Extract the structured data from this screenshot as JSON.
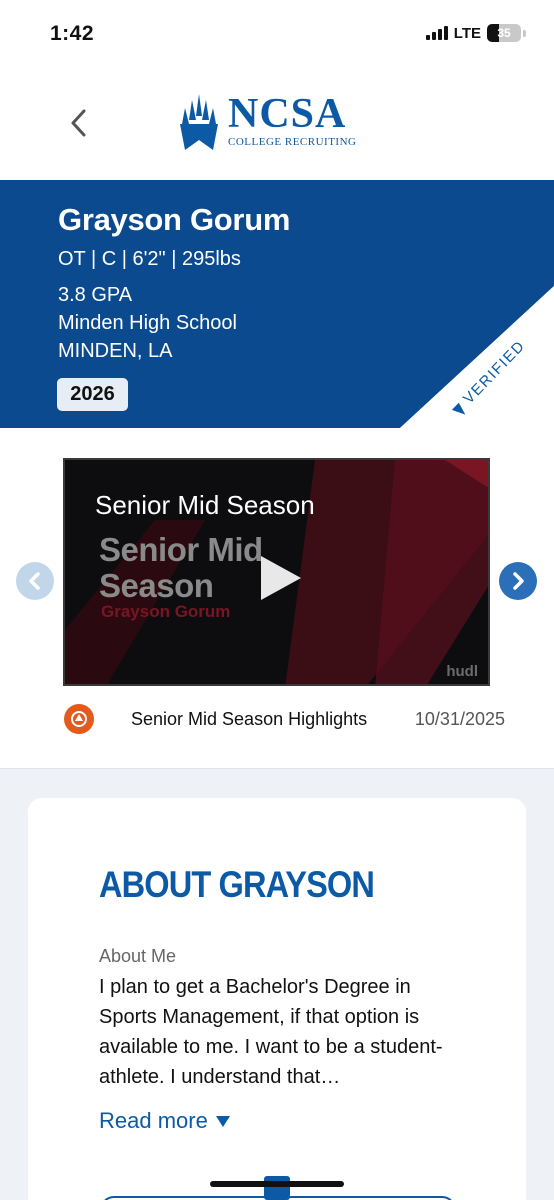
{
  "status_bar": {
    "time": "1:42",
    "network": "LTE",
    "battery": "35",
    "battery_level": 0.35
  },
  "header": {
    "logo_word": "NCSA",
    "logo_sub": "COLLEGE RECRUITING"
  },
  "profile": {
    "name": "Grayson Gorum",
    "stats": "OT | C | 6'2\" | 295lbs",
    "gpa": "3.8 GPA",
    "school": "Minden High School",
    "location": "MINDEN, LA",
    "class_year": "2026",
    "verified": "VERIFIED"
  },
  "video": {
    "title": "Senior Mid Season",
    "card_big_line1": "Senior Mid",
    "card_big_line2": "Season",
    "card_small": "Grayson Gorum",
    "watermark": "hudl",
    "caption": "Senior Mid Season Highlights",
    "date": "10/31/2025"
  },
  "about": {
    "title": "ABOUT GRAYSON",
    "label": "About Me",
    "text": "I plan to get a Bachelor's Degree in Sports Management, if that option is available to me. I want to be a student-athlete. I understand that…",
    "read_more": "Read more"
  },
  "colors": {
    "brand_blue": "#0c5aa6",
    "banner_blue": "#0c4a8f",
    "hudl_orange": "#e25a1c"
  },
  "icons": [
    "back-chevron-icon",
    "ncsa-logo-icon",
    "verified-check-icon",
    "play-icon",
    "chevron-left-icon",
    "chevron-right-icon",
    "hudl-icon",
    "caret-down-icon"
  ]
}
